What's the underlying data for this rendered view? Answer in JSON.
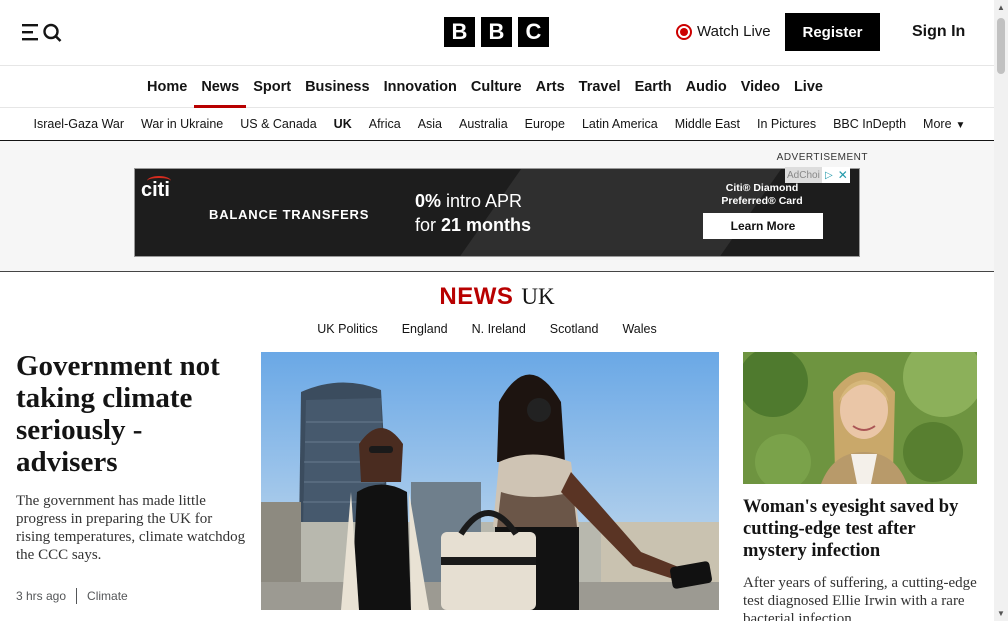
{
  "header": {
    "logo_letters": [
      "B",
      "B",
      "C"
    ],
    "watch_live": "Watch Live",
    "register": "Register",
    "sign_in": "Sign In",
    "icons": [
      "menu-icon",
      "search-icon",
      "live-icon"
    ]
  },
  "main_nav": {
    "items": [
      "Home",
      "News",
      "Sport",
      "Business",
      "Innovation",
      "Culture",
      "Arts",
      "Travel",
      "Earth",
      "Audio",
      "Video",
      "Live"
    ],
    "active": "News"
  },
  "sub_nav": {
    "items": [
      "Israel-Gaza War",
      "War in Ukraine",
      "US & Canada",
      "UK",
      "Africa",
      "Asia",
      "Australia",
      "Europe",
      "Latin America",
      "Middle East",
      "In Pictures",
      "BBC InDepth",
      "More"
    ],
    "active": "UK"
  },
  "ad": {
    "label": "ADVERTISEMENT",
    "brand": "citi",
    "headline": "BALANCE TRANSFERS",
    "offer_line1_bold": "0%",
    "offer_line1_rest": " intro APR",
    "offer_line2_prefix": "for ",
    "offer_line2_bold": "21 months",
    "card_line1": "Citi® Diamond",
    "card_line2": "Preferred® Card",
    "cta": "Learn More",
    "adchoices": "AdChoi"
  },
  "section": {
    "news_word": "NEWS",
    "region": "UK",
    "links": [
      "UK Politics",
      "England",
      "N. Ireland",
      "Scotland",
      "Wales"
    ]
  },
  "lead_story": {
    "headline": "Government not taking climate seriously - advisers",
    "summary": "The government has made little progress in preparing the UK for rising temperatures, climate watchdog the CCC says.",
    "time": "3 hrs ago",
    "topic": "Climate"
  },
  "side_story": {
    "headline": "Woman's eyesight saved by cutting-edge test after mystery infection",
    "summary": "After years of suffering, a cutting-edge test diagnosed Ellie Irwin with a rare bacterial infection."
  },
  "colors": {
    "accent": "#b80000",
    "text": "#141414",
    "live_red": "#cc0000"
  }
}
